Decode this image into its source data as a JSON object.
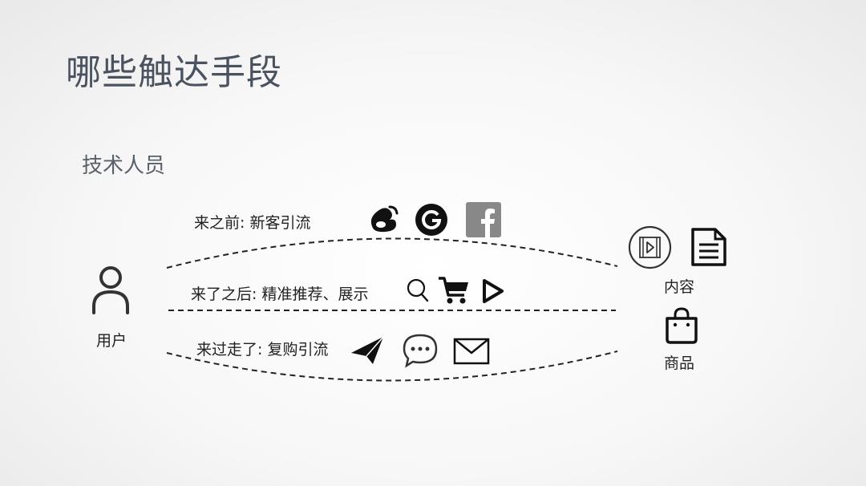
{
  "title": "哪些触达手段",
  "subtitle": "技术人员",
  "user": {
    "label": "用户",
    "icon": "user-icon"
  },
  "targets": [
    {
      "label": "内容",
      "icons": [
        "video-icon",
        "document-icon"
      ]
    },
    {
      "label": "商品",
      "icons": [
        "shopping-bag-icon"
      ]
    }
  ],
  "channels": [
    {
      "label": "来之前: 新客引流",
      "icons": [
        "weibo-icon",
        "google-icon",
        "facebook-icon"
      ]
    },
    {
      "label": "来了之后: 精准推荐、展示",
      "icons": [
        "search-icon",
        "shopping-cart-icon",
        "play-icon"
      ]
    },
    {
      "label": "来过走了: 复购引流",
      "icons": [
        "paper-plane-icon",
        "chat-bubble-icon",
        "mail-icon"
      ]
    }
  ],
  "colors": {
    "title": "#4a5260",
    "line": "#222222",
    "facebook": "#888888"
  }
}
